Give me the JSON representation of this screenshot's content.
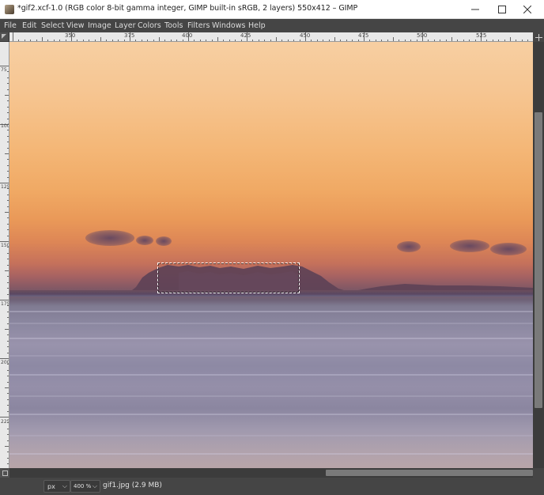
{
  "window": {
    "title": "*gif2.xcf-1.0 (RGB color 8-bit gamma integer, GIMP built-in sRGB, 2 layers) 550x412 – GIMP",
    "app_icon": "gimp-icon"
  },
  "menu": {
    "items": [
      "File",
      "Edit",
      "Select",
      "View",
      "Image",
      "Layer",
      "Colors",
      "Tools",
      "Filters",
      "Windows",
      "Help"
    ]
  },
  "rulers": {
    "horizontal_ticks": [
      "350",
      "375",
      "400",
      "425",
      "450",
      "475",
      "500",
      "525"
    ],
    "vertical_ticks": [
      "75",
      "100",
      "125",
      "150",
      "175",
      "200",
      "225"
    ]
  },
  "statusbar": {
    "unit": "px",
    "zoom": "400 %",
    "status": "gif1.jpg (2.9 MB)"
  },
  "colors": {
    "chrome_dark": "#454545",
    "ruler_bg": "#e8e8e8",
    "sky_top": "#f7cfa2",
    "sky_mid": "#f0a964",
    "horizon": "#805865",
    "water": "#8b87a0"
  }
}
